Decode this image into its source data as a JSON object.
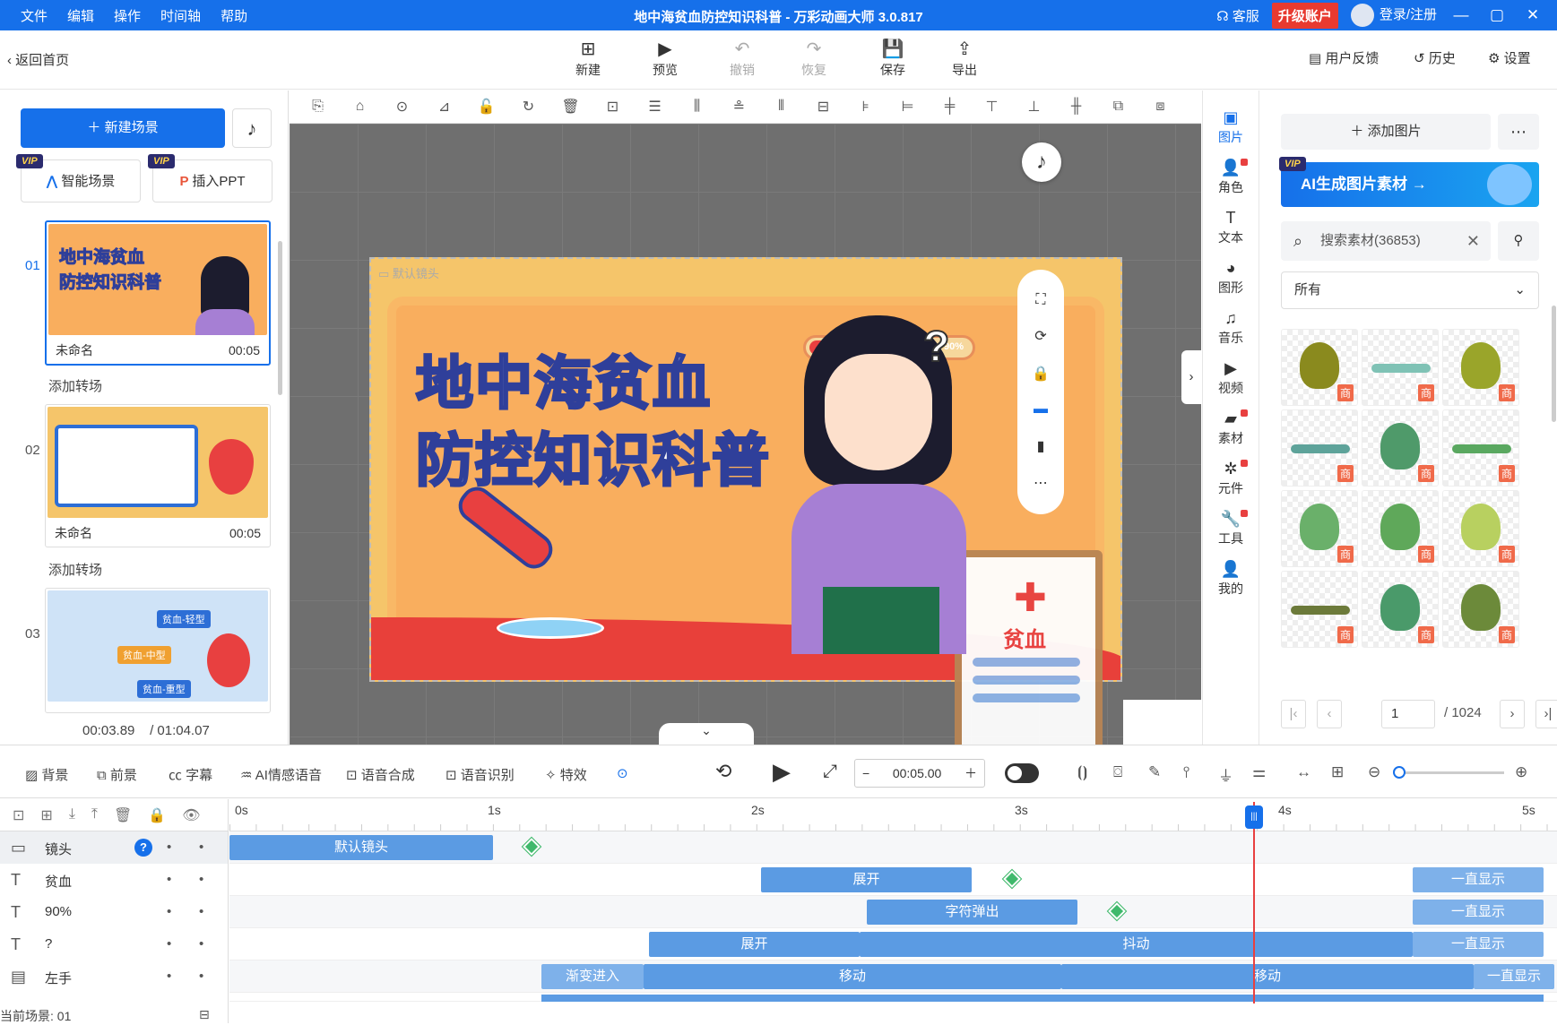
{
  "window": {
    "menu": [
      "文件",
      "编辑",
      "操作",
      "时间轴",
      "帮助"
    ],
    "title": "地中海贫血防控知识科普 - 万彩动画大师 3.0.817",
    "support": "客服",
    "upgrade": "升级账户",
    "login": "登录/注册",
    "brand_color": "#1670ea"
  },
  "toolbar": {
    "back": "返回首页",
    "new": "新建",
    "preview": "预览",
    "undo": "撤销",
    "redo": "恢复",
    "save": "保存",
    "export": "导出",
    "feedback": "用户反馈",
    "history": "历史",
    "settings": "设置"
  },
  "left": {
    "new_scene": "新建场景",
    "smart_scene": "智能场景",
    "insert_ppt": "插入PPT",
    "vip": "VIP",
    "add_transition": "添加转场",
    "scenes": [
      {
        "num": "01",
        "name": "未命名",
        "dur": "00:05"
      },
      {
        "num": "02",
        "name": "未命名",
        "dur": "00:05"
      },
      {
        "num": "03",
        "name": "未命名",
        "dur": ""
      }
    ],
    "current_time": "00:03.89",
    "total_time": "/ 01:04.07"
  },
  "stage": {
    "default_cam": "默认镜头",
    "title_line1": "地中海贫血",
    "title_line2": "防控知识科普",
    "progress_label": "90%",
    "progress": 0.9,
    "board_text": "贫血",
    "question": "?"
  },
  "thumbs": {
    "t1_line1": "地中海贫血",
    "t1_line2": "防控知识科普",
    "t3_a": "贫血-轻型",
    "t3_b": "贫血-中型",
    "t3_c": "贫血-重型"
  },
  "iconcol": [
    "图片",
    "角色",
    "文本",
    "图形",
    "音乐",
    "视频",
    "素材",
    "元件",
    "工具",
    "我的"
  ],
  "assets": {
    "add_image": "添加图片",
    "ai_banner": "AI生成图片素材 →",
    "search_placeholder": "搜索素材(36853)",
    "filter_value": "所有",
    "badge": "商",
    "page": "1",
    "pages": "/ 1024"
  },
  "tlbar": {
    "bg": "背景",
    "fg": "前景",
    "subtitle": "字幕",
    "ai_voice": "AI情感语音",
    "tts": "语音合成",
    "asr": "语音识别",
    "fx": "特效",
    "time": "00:05.00"
  },
  "timeline": {
    "ruler": [
      "0s",
      "1s",
      "2s",
      "3s",
      "4s",
      "5s"
    ],
    "tracks": [
      {
        "name": "镜头",
        "icon": "camera-icon"
      },
      {
        "name": "贫血",
        "icon": "text-icon"
      },
      {
        "name": "90%",
        "icon": "text-icon"
      },
      {
        "name": "?",
        "icon": "text-icon"
      },
      {
        "name": "左手",
        "icon": "image-icon"
      }
    ],
    "clips": {
      "cam": "默认镜头",
      "expand": "展开",
      "always": "一直显示",
      "typewriter": "字符弹出",
      "shake": "抖动",
      "fadein": "渐变进入",
      "move": "移动"
    },
    "current_scene": "当前场景: 01"
  }
}
